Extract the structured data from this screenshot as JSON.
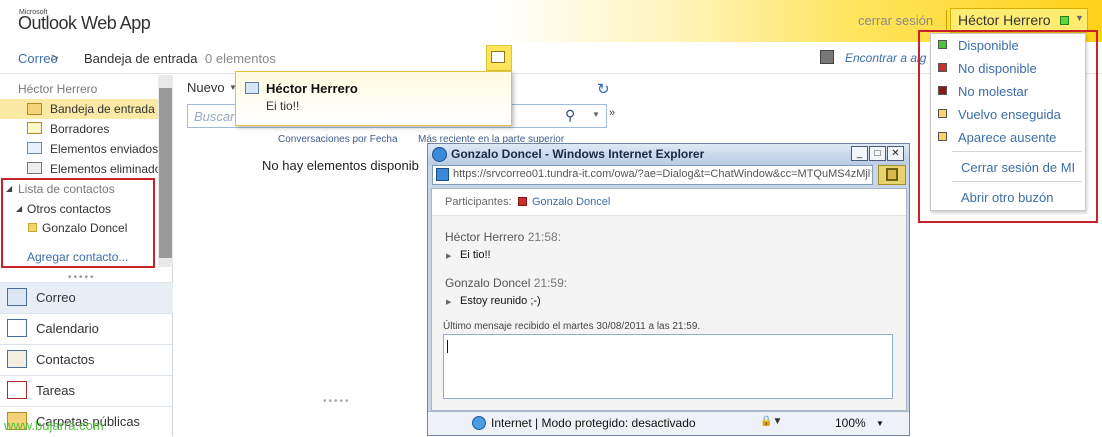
{
  "header": {
    "brand_small": "Microsoft",
    "brand": "Outlook Web App",
    "signout": "cerrar sesión",
    "user_name": "Héctor Herrero"
  },
  "breadcrumb": {
    "mail": "Correo",
    "separator": ">",
    "folder": "Bandeja de entrada",
    "count": "0 elementos",
    "find": "Encontrar a alg"
  },
  "nav": {
    "user": "Héctor Herrero",
    "folders": [
      {
        "label": "Bandeja de entrada"
      },
      {
        "label": "Borradores"
      },
      {
        "label": "Elementos enviados"
      },
      {
        "label": "Elementos eliminados"
      }
    ],
    "contacts_title": "Lista de contactos",
    "other_contacts": "Otros contactos",
    "contact": "Gonzalo Doncel",
    "add_contact": "Agregar contacto...",
    "modules": [
      {
        "label": "Correo"
      },
      {
        "label": "Calendario"
      },
      {
        "label": "Contactos"
      },
      {
        "label": "Tareas"
      },
      {
        "label": "Carpetas públicas"
      }
    ]
  },
  "list": {
    "new_label": "Nuevo",
    "search_placeholder": "Buscar",
    "sort_by": "Conversaciones por Fecha",
    "sort_order": "Más reciente en la parte superior",
    "empty": "No hay elementos disponib"
  },
  "toast": {
    "title": "Héctor Herrero",
    "message": "Ei tio!!"
  },
  "chat_window": {
    "title": "Gonzalo Doncel - Windows Internet Explorer",
    "url": "https://srvcorreo01.tundra-it.com/owa/?ae=Dialog&t=ChatWindow&cc=MTQuMS4zMjl",
    "participants_label": "Participantes:",
    "participant": "Gonzalo Doncel",
    "messages": [
      {
        "sender": "Héctor Herrero",
        "time": "21:58:",
        "text": "Ei tio!!"
      },
      {
        "sender": "Gonzalo Doncel",
        "time": "21:59:",
        "text": "Estoy reunido ;-)"
      }
    ],
    "last_message": "Último mensaje recibido el martes 30/08/2011 a las 21:59.",
    "status_text": "Internet | Modo protegido: desactivado",
    "zoom": "100%"
  },
  "presence_menu": {
    "items": [
      {
        "label": "Disponible",
        "color": "#4cc23a"
      },
      {
        "label": "No disponible",
        "color": "#c9302c"
      },
      {
        "label": "No molestar",
        "color": "#8b1a1a"
      },
      {
        "label": "Vuelvo enseguida",
        "color": "#f3d56a"
      },
      {
        "label": "Aparece ausente",
        "color": "#f3d56a"
      }
    ],
    "signout_im": "Cerrar sesión de MI",
    "open_mailbox": "Abrir otro buzón"
  },
  "watermark": "www.bujarra.com"
}
